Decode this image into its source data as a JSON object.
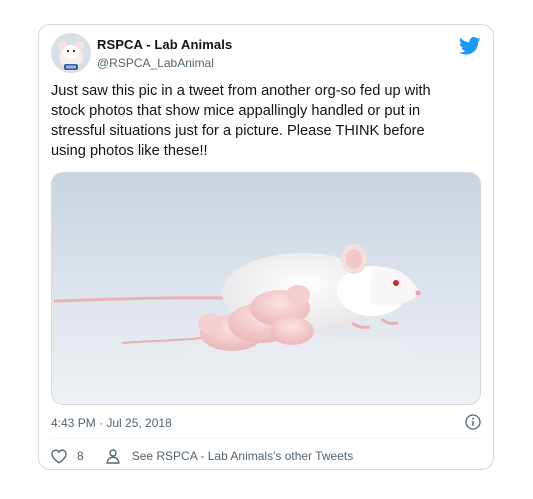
{
  "tweet": {
    "author_name": "RSPCA - Lab Animals",
    "author_handle": "@RSPCA_LabAnimal",
    "text": "Just saw this pic in a tweet from another org-so fed up with\nstock photos that show mice appallingly handled or put in\nstressful situations just for a picture. Please THINK before\nusing photos like these!!",
    "timestamp": "4:43 PM · Jul 25, 2018",
    "like_count": "8",
    "other_tweets_label": "See RSPCA - Lab Animals's other Tweets"
  },
  "icons": {
    "brand": "twitter-bird-icon",
    "info": "info-icon",
    "like": "heart-icon",
    "profile": "person-icon"
  },
  "colors": {
    "twitter_blue": "#1d9bf0",
    "text_primary": "#0f1419",
    "text_secondary": "#536471",
    "border": "#cfd9de"
  }
}
